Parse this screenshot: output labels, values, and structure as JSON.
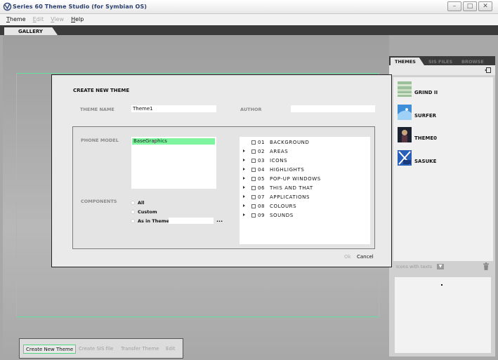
{
  "window": {
    "title": "Series 60 Theme Studio (for Symbian OS)",
    "min_glyph": "–",
    "max_glyph": "□",
    "close_glyph": "✕"
  },
  "menu": [
    {
      "label": "Theme",
      "accel": "T",
      "rest": "heme",
      "enabled": true
    },
    {
      "label": "Edit",
      "accel": "E",
      "rest": "dit",
      "enabled": false
    },
    {
      "label": "View",
      "accel": "V",
      "rest": "iew",
      "enabled": false
    },
    {
      "label": "Help",
      "accel": "H",
      "rest": "elp",
      "enabled": true
    }
  ],
  "main_tab": "GALLERY",
  "right_panel": {
    "tabs": [
      "THEMES",
      "SIS FILES",
      "BROWSE"
    ],
    "themes": [
      "GRIND II",
      "SURFER",
      "THEME0",
      "SASUKE"
    ],
    "view_mode": "Icons with texts",
    "view_arrow": "▼"
  },
  "bottom_toolbar": [
    "Create New Theme",
    "Create SIS file",
    "Transfer Theme",
    "Edit"
  ],
  "dialog": {
    "title": "CREATE NEW THEME",
    "theme_name_label": "THEME NAME",
    "theme_name_value": "Theme1",
    "author_label": "AUTHOR",
    "author_value": "",
    "phone_model_label": "PHONE MODEL",
    "phone_models": [
      "BaseGraphics"
    ],
    "components_label": "COMPONENTS",
    "component_options": [
      "All",
      "Custom",
      "As in Theme"
    ],
    "browse_label": "...",
    "components": [
      {
        "num": "01",
        "label": "BACKGROUND",
        "expandable": false
      },
      {
        "num": "02",
        "label": "AREAS",
        "expandable": true
      },
      {
        "num": "03",
        "label": "ICONS",
        "expandable": true
      },
      {
        "num": "04",
        "label": "HIGHLIGHTS",
        "expandable": true
      },
      {
        "num": "05",
        "label": "POP-UP WINDOWS",
        "expandable": true
      },
      {
        "num": "06",
        "label": "THIS AND THAT",
        "expandable": true
      },
      {
        "num": "07",
        "label": "APPLICATIONS",
        "expandable": true
      },
      {
        "num": "08",
        "label": "COLOURS",
        "expandable": true
      },
      {
        "num": "09",
        "label": "SOUNDS",
        "expandable": true
      }
    ],
    "ok_label": "Ok",
    "cancel_label": "Cancel"
  },
  "colors": {
    "accent_green": "#4fd480",
    "selection_green": "#7ff5a0",
    "title_blue": "#2b3f6d"
  }
}
